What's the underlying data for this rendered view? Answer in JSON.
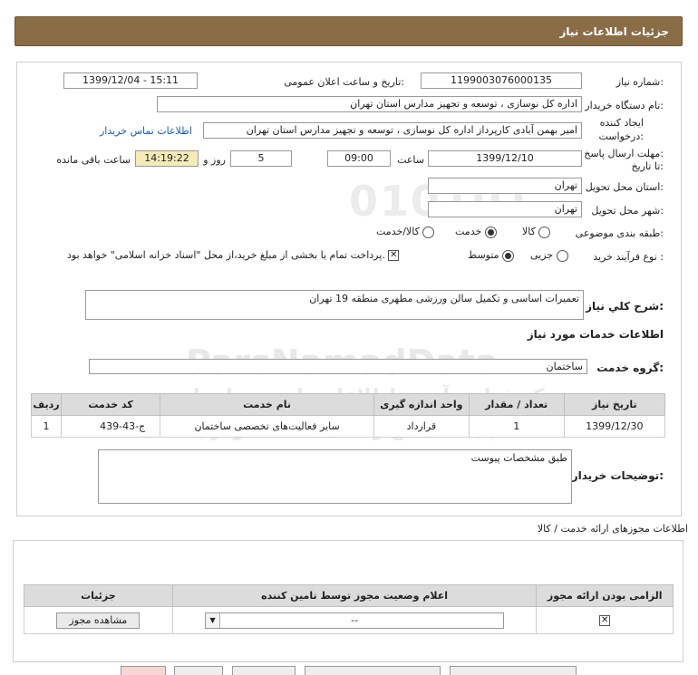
{
  "header": {
    "title": "جزئیات اطلاعات نیاز"
  },
  "watermark": {
    "line1": "010101",
    "line2": "ParsNamadData",
    "line3": "مرکز فراهم آوری اطلاعات پارس نماد داده",
    "line4": "پایگاه اطلاع رسانی مناقصه ومزایده",
    "phone": "۰۲۱-۸۸۳۴۹۶۷۰-۵"
  },
  "form": {
    "need_number_label": "شماره نیاز:",
    "need_number": "1199003076000135",
    "announce_label": "تاریخ و ساعت اعلان عمومی:",
    "announce_value": "1399/12/04 - 15:11",
    "buyer_label": "نام دستگاه خریدار:",
    "buyer_value": "اداره کل نوسازی ، توسعه و تجهیز مدارس استان تهران",
    "creator_label1": "ایجاد کننده",
    "creator_label2": "درخواست:",
    "creator_value": "امیر بهمن آبادی کارپرداز اداره کل نوسازی ، توسعه و تجهیز مدارس استان تهران",
    "contact_link": "اطلاعات تماس خریدار",
    "deadline_label1": "مهلت ارسال پاسخ:",
    "deadline_label2": "تا تاریخ:",
    "deadline_date": "1399/12/10",
    "time_label": "ساعت",
    "deadline_time": "09:00",
    "days_value": "5",
    "days_label": "روز و",
    "remaining_time": "14:19:22",
    "remaining_label": "ساعت باقی مانده",
    "province_label": "استان محل تحویل:",
    "province_value": "تهران",
    "city_label": "شهر محل تحویل:",
    "city_value": "تهران",
    "category_label": "طبقه بندی موضوعی:",
    "category_options": [
      "کالا",
      "خدمت",
      "کالا/خدمت"
    ],
    "category_selected": "خدمت",
    "process_label": "نوع فرآیند خرید :",
    "process_options": [
      "جزیی",
      "متوسط"
    ],
    "process_selected": "متوسط",
    "payment_note": "پرداخت تمام یا بخشی از مبلغ خرید،از محل \"اسناد خزانه اسلامی\" خواهد بود.",
    "summary_label": "شرح كلي نياز:",
    "summary_value": "تعمیرات اساسی و تکمیل سالن ورزشی مطهری منطقه 19 تهران",
    "services_title": "اطلاعات خدمات مورد نیاز",
    "service_group_label": "گروه خدمت:",
    "service_group_value": "ساختمان",
    "buyer_notes_label": "توضیحات خریدار:",
    "buyer_notes_value": "طبق مشخصات پیوست"
  },
  "services_table": {
    "headers": [
      "ردیف",
      "کد خدمت",
      "نام خدمت",
      "واحد اندازه گیری",
      "تعداد / مقدار",
      "تاریخ نیاز"
    ],
    "rows": [
      [
        "1",
        "ج-43-439",
        "سایر فعالیت‌های تخصصی ساختمان",
        "قرارداد",
        "1",
        "1399/12/30"
      ]
    ]
  },
  "permits": {
    "title": "اطلاعات مجوزهای ارائه خدمت / کالا",
    "headers": [
      "الزامی بودن ارائه مجوز",
      "اعلام وضعیت مجوز توسط تامین کننده",
      "جزئیات"
    ],
    "row": {
      "status_value": "--",
      "view_button": "مشاهده مجوز"
    }
  }
}
